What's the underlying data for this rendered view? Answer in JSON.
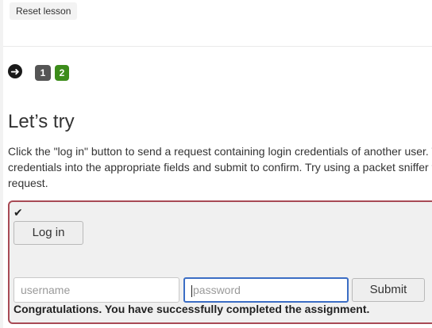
{
  "toolbar": {
    "reset_label": "Reset lesson"
  },
  "pagination": {
    "back_icon": "arrow-left-icon",
    "pages": [
      {
        "label": "1",
        "color": "#555555"
      },
      {
        "label": "2",
        "color": "#3c8c1a",
        "current": true
      }
    ]
  },
  "content": {
    "title": "Let’s try",
    "description_lines": [
      "Click the \"log in\" button to send a request containing login credentials of another user. T",
      "credentials into the appropriate fields and submit to confirm. Try using a packet sniffer t",
      "request."
    ]
  },
  "assignment": {
    "border_color": "#a84a55",
    "status_icon": "checkmark-icon",
    "login_button_label": "Log in",
    "username_placeholder": "username",
    "username_value": "",
    "password_placeholder": "password",
    "password_value": "",
    "submit_label": "Submit",
    "feedback": "Congratulations. You have successfully completed the assignment."
  }
}
